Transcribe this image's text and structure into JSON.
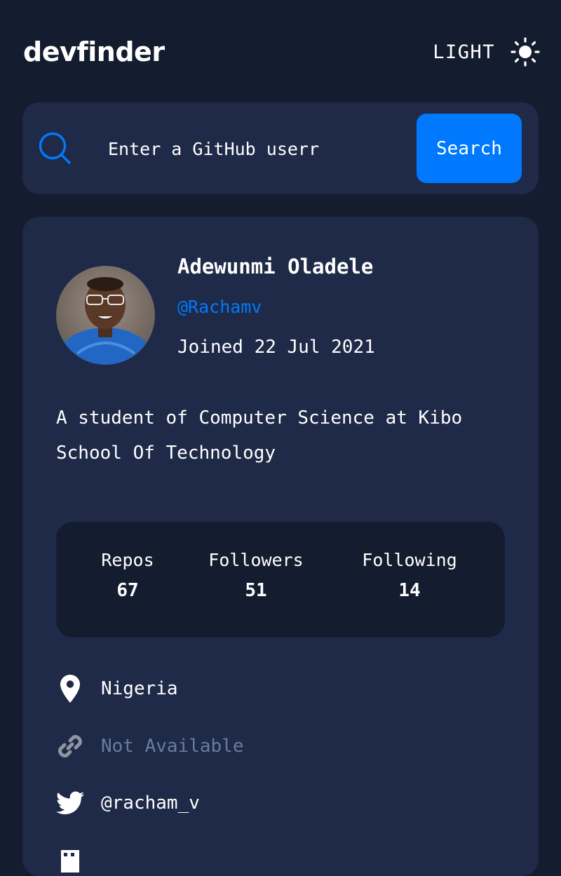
{
  "header": {
    "logo": "devfinder",
    "theme_toggle_label": "LIGHT"
  },
  "search": {
    "placeholder": "Enter a GitHub userr",
    "button_label": "Search"
  },
  "profile": {
    "name": "Adewunmi Oladele",
    "handle": "@Rachamv",
    "joined": "Joined 22 Jul 2021",
    "bio": "A student of Computer Science at Kibo School Of Technology"
  },
  "stats": {
    "repos": {
      "label": "Repos",
      "value": "67"
    },
    "followers": {
      "label": "Followers",
      "value": "51"
    },
    "following": {
      "label": "Following",
      "value": "14"
    }
  },
  "links": {
    "location": "Nigeria",
    "website": "Not Available",
    "twitter": "@racham_v"
  },
  "colors": {
    "background": "#141d2f",
    "card": "#1e2a47",
    "accent": "#0079ff",
    "muted": "#697c9a"
  }
}
